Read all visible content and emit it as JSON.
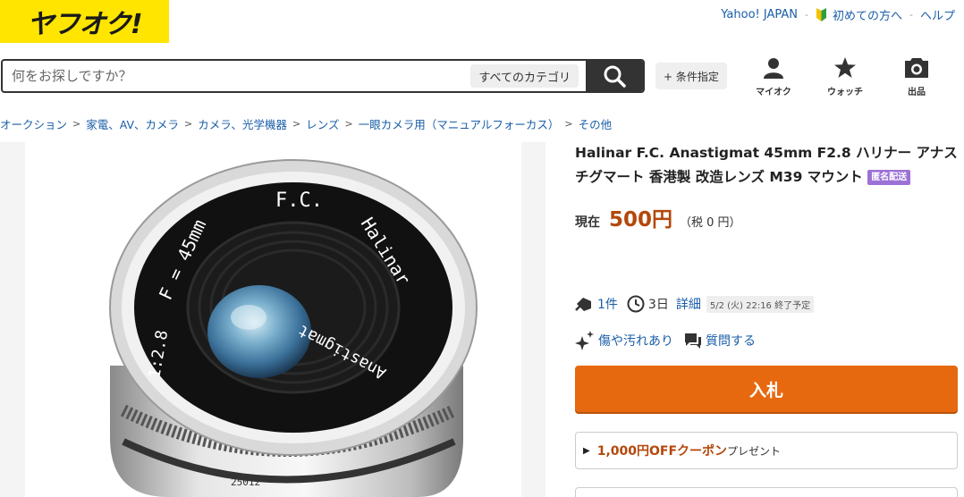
{
  "header": {
    "logo": "ヤフオク!",
    "top_links": [
      {
        "label": "Yahoo! JAPAN"
      },
      {
        "label": "初めての方へ"
      },
      {
        "label": "ヘルプ"
      }
    ],
    "separator": "-",
    "search": {
      "placeholder": "何をお探しですか？",
      "category_label": "すべてのカテゴリ"
    },
    "filter_label": "+ 条件指定",
    "icons": [
      {
        "name": "myauc",
        "label": "マイオク"
      },
      {
        "name": "watch",
        "label": "ウォッチ"
      },
      {
        "name": "sell",
        "label": "出品"
      }
    ]
  },
  "breadcrumb": [
    "オークション",
    "家電、AV、カメラ",
    "カメラ、光学機器",
    "レンズ",
    "一眼カメラ用（マニュアルフォーカス）",
    "その他"
  ],
  "breadcrumb_sep": ">",
  "product": {
    "title": "Halinar F.C. Anastigmat 45mm F2.8 ハリナー アナスチグマート 香港製 改造レンズ M39 マウント",
    "anon_badge": "匿名配送",
    "price_label": "現在",
    "price_value": "500円",
    "price_tax": "（税 0 円）",
    "bid_count": "1件",
    "remaining": "3日",
    "detail_label": "詳細",
    "end_time": "5/2 (火) 22:16 終了予定",
    "condition": "傷や汚れあり",
    "question": "質問する",
    "bid_button": "入札",
    "coupon_strong": "1,000円OFFクーポン",
    "coupon_rest": "プレゼント"
  },
  "lens_engravings": {
    "top": "F.C.",
    "left": "F = 45mm",
    "brand": "Halinar",
    "aperture": "1:2.8",
    "bottom": "Anastigmat",
    "serial": "25012"
  },
  "colors": {
    "logo_bg": "#ffe500",
    "link": "#1a5ea8",
    "price": "#b4470a",
    "bid_button": "#e7690f",
    "badge": "#9c71d6"
  }
}
